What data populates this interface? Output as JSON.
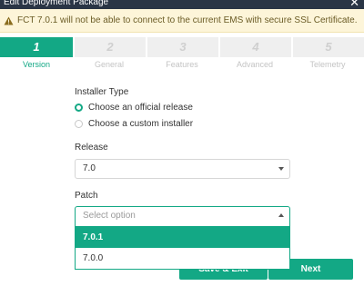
{
  "window": {
    "title": "Edit Deployment Package",
    "close_glyph": "✕"
  },
  "warning": {
    "icon": "warning-icon",
    "text": "FCT 7.0.1 will not be able to connect to the current EMS with secure SSL Certificate."
  },
  "steps": [
    {
      "num": "1",
      "label": "Version",
      "active": true
    },
    {
      "num": "2",
      "label": "General",
      "active": false
    },
    {
      "num": "3",
      "label": "Features",
      "active": false
    },
    {
      "num": "4",
      "label": "Advanced",
      "active": false
    },
    {
      "num": "5",
      "label": "Telemetry",
      "active": false
    }
  ],
  "form": {
    "installer_type_label": "Installer Type",
    "options": [
      {
        "label": "Choose an official release",
        "checked": true
      },
      {
        "label": "Choose a custom installer",
        "checked": false
      }
    ],
    "release_label": "Release",
    "release_value": "7.0",
    "patch_label": "Patch",
    "patch_placeholder": "Select option",
    "patch_options": [
      {
        "label": "7.0.1",
        "highlighted": true
      },
      {
        "label": "7.0.0",
        "highlighted": false
      }
    ]
  },
  "buttons": {
    "save_exit": "Save & Exit",
    "next": "Next"
  },
  "colors": {
    "accent": "#13a885",
    "titlebar": "#2a3545",
    "warning_bg": "#fdf5d9"
  }
}
